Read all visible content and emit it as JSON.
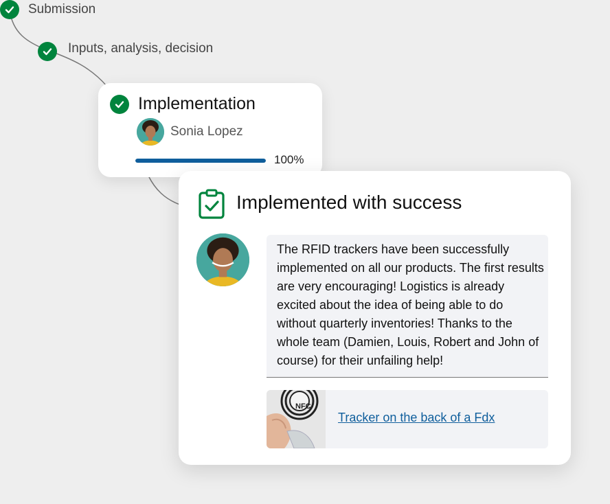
{
  "steps": [
    {
      "label": "Submission",
      "status": "done"
    },
    {
      "label": "Inputs, analysis, decision",
      "status": "done"
    }
  ],
  "implementation_card": {
    "title": "Implementation",
    "assignee": "Sonia Lopez",
    "progress": 100,
    "progress_label": "100%"
  },
  "success_card": {
    "title": "Implemented with success",
    "comment": "The RFID trackers have been successfully implemented on all our products. The first results are very encouraging! Logistics is already excited about the idea of being able to do without quarterly inventories! Thanks to the whole team (Damien, Louis, Robert and John of course) for their unfailing help!",
    "attachment": {
      "label": "Tracker on the back of a Fdx",
      "thumbnail_text": "NFC"
    }
  },
  "colors": {
    "check_green": "#00843d",
    "progress_blue": "#0f5e9c",
    "link_blue": "#0f5e9c",
    "avatar_teal": "#47a79e",
    "comment_bg": "#f2f3f6"
  },
  "icons": {
    "step_status": "check-circle-icon",
    "success_card": "clipboard-check-icon"
  }
}
